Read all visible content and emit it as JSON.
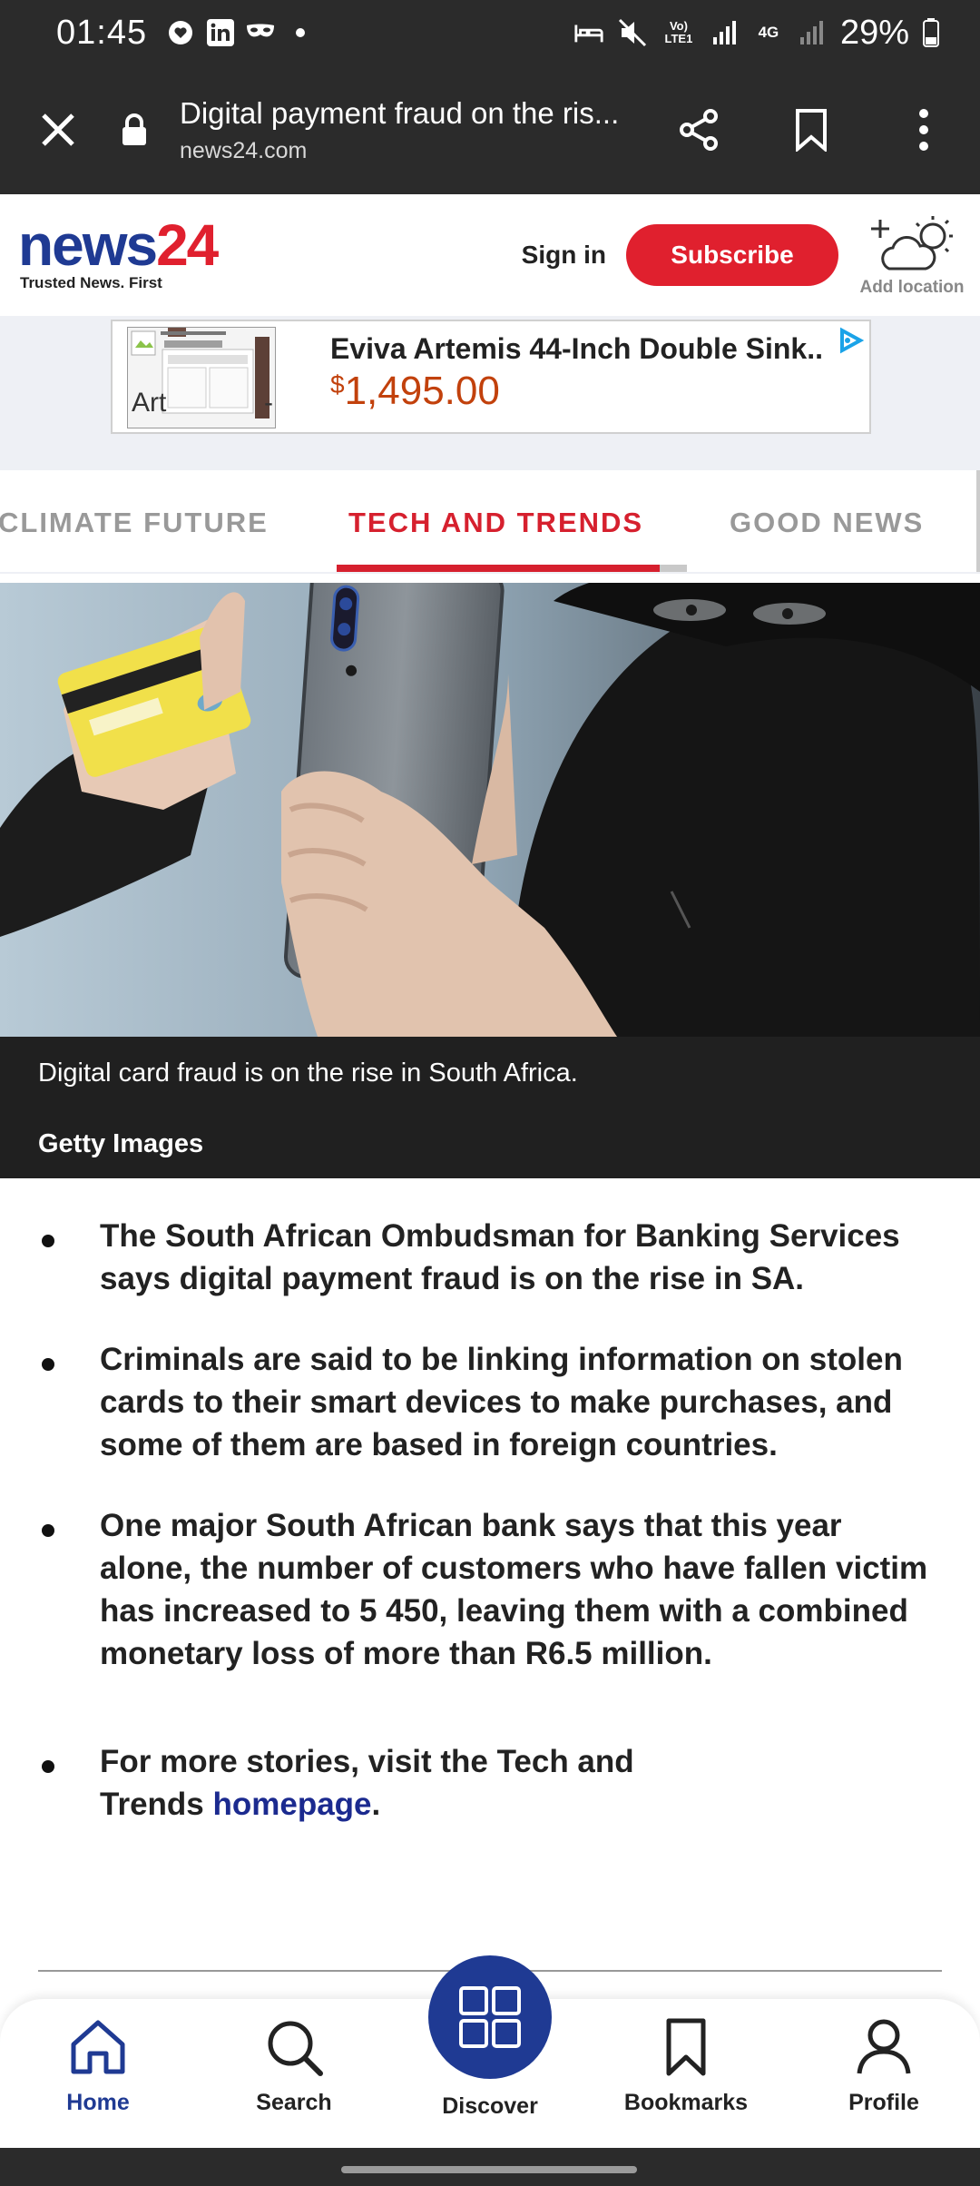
{
  "status_bar": {
    "time": "01:45",
    "battery": "29%",
    "network_label": "4G",
    "volte_label": "Vo) LTE1"
  },
  "browser": {
    "page_title": "Digital payment fraud on the ris...",
    "domain": "news24.com"
  },
  "site_header": {
    "logo_news": "news",
    "logo_24": "24",
    "tagline": "Trusted News. First",
    "sign_in": "Sign in",
    "subscribe": "Subscribe",
    "add_location": "Add location"
  },
  "ad": {
    "title": "Eviva Artemis 44-Inch Double Sink..",
    "currency": "$",
    "price": "1,495.00",
    "alt_text_left": "Art",
    "alt_text_right": "-"
  },
  "tabs": [
    {
      "label": "CLIMATE FUTURE",
      "active": false
    },
    {
      "label": "TECH AND TRENDS",
      "active": true
    },
    {
      "label": "GOOD NEWS",
      "active": false
    }
  ],
  "hero": {
    "caption": "Digital card fraud is on the rise in South Africa.",
    "credit": "Getty Images"
  },
  "bullets": [
    "The South African Ombudsman for Banking Services says digital payment fraud is on the rise in SA.",
    "Criminals are said to be linking information on stolen cards to their smart devices to make purchases, and some of them are based in foreign countries.",
    "One major South African bank says that this year alone, the number of customers who have fallen victim has increased to 5 450, leaving them with a combined monetary loss of more than R6.5 million."
  ],
  "more_stories": {
    "prefix": "For more stories, visit the Tech and Trends ",
    "link": "homepage",
    "suffix": "."
  },
  "bottom_nav": {
    "home": "Home",
    "search": "Search",
    "discover": "Discover",
    "bookmarks": "Bookmarks",
    "profile": "Profile"
  },
  "colors": {
    "brand_blue": "#1f3a93",
    "brand_red": "#e0202e",
    "price_orange": "#c2410c"
  }
}
